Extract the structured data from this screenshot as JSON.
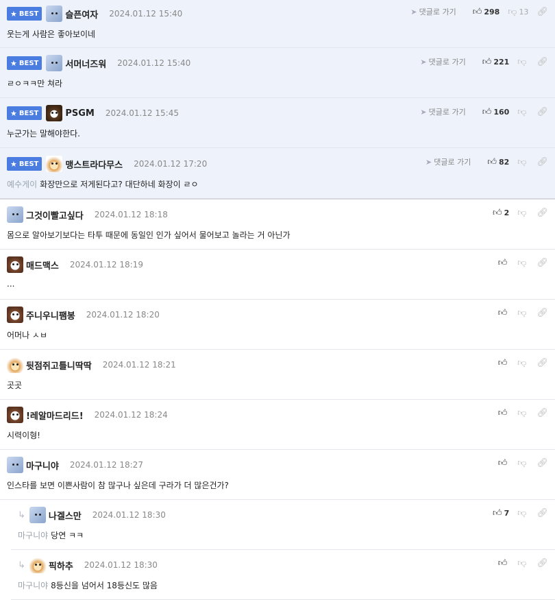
{
  "labels": {
    "best": "BEST",
    "goto": "댓글로 가기"
  },
  "comments": [
    {
      "nick": "슬픈여자",
      "date": "2024.01.12 15:40",
      "text": "웃는게 사람은 좋아보이네",
      "likes": "298",
      "dislikes": "13",
      "avatar": "blue"
    },
    {
      "nick": "서머너즈워",
      "date": "2024.01.12 15:40",
      "text": "ㄹㅇㅋㅋ만 쳐라",
      "likes": "221",
      "avatar": "blue"
    },
    {
      "nick": "PSGM",
      "date": "2024.01.12 15:45",
      "text": "누군가는 말해야한다.",
      "likes": "160",
      "avatar": "bear"
    },
    {
      "nick": "맹스트라다무스",
      "date": "2024.01.12 17:20",
      "tag": "예수게이",
      "text": "화장만으로 저게된다고? 대단하네 화장이 ㄹㅇ",
      "likes": "82",
      "avatar": "fox"
    },
    {
      "nick": "그것이빨고싶다",
      "date": "2024.01.12 18:18",
      "text": "몸으로 알아보기보다는 타투 때문에 동일인 인가 싶어서 물어보고 놀라는 거 아닌가",
      "likes": "2",
      "avatar": "blue"
    },
    {
      "nick": "매드맥스",
      "date": "2024.01.12 18:19",
      "text": "...",
      "avatar": "dog"
    },
    {
      "nick": "주니우니팸봉",
      "date": "2024.01.12 18:20",
      "text": "어머나 ㅅㅂ",
      "avatar": "dog"
    },
    {
      "nick": "뒷점쥐고틀니딱딱",
      "date": "2024.01.12 18:21",
      "text": "곳곳",
      "avatar": "fox"
    },
    {
      "nick": "!레알마드리드!",
      "date": "2024.01.12 18:24",
      "text": "시력이형!",
      "avatar": "dog"
    },
    {
      "nick": "마구니야",
      "date": "2024.01.12 18:27",
      "text": "인스타를 보면 이쁜사람이 참 많구나 싶은데 구라가 더 많은건가?",
      "avatar": "blue"
    },
    {
      "nick": "나겔스만",
      "date": "2024.01.12 18:30",
      "tag": "마구니야",
      "text": "당연 ㅋㅋ",
      "likes": "7",
      "avatar": "blue"
    },
    {
      "nick": "픽하추",
      "date": "2024.01.12 18:30",
      "tag": "마구니야",
      "text": "8등신을 넘어서 18등신도 많음",
      "avatar": "fox"
    }
  ]
}
